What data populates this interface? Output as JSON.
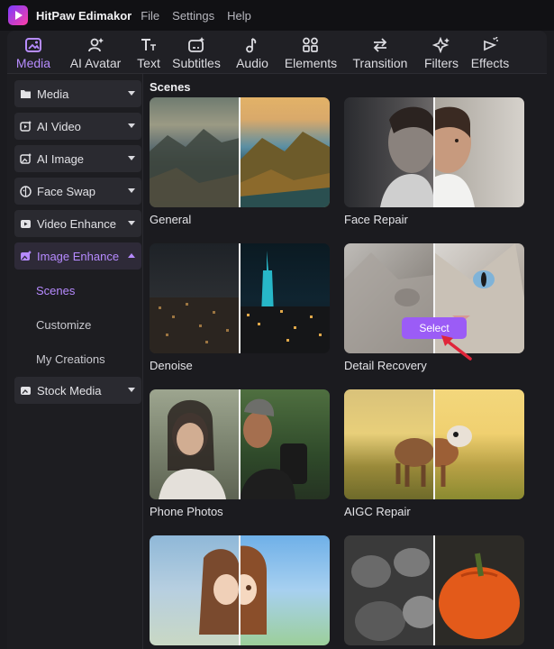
{
  "app": {
    "title": "HitPaw Edimakor"
  },
  "menu": [
    "File",
    "Settings",
    "Help"
  ],
  "toolbar": [
    {
      "label": "Media",
      "icon": "media-icon",
      "active": true
    },
    {
      "label": "AI Avatar",
      "icon": "avatar-icon"
    },
    {
      "label": "Text",
      "icon": "text-icon"
    },
    {
      "label": "Subtitles",
      "icon": "subtitles-icon"
    },
    {
      "label": "Audio",
      "icon": "audio-icon"
    },
    {
      "label": "Elements",
      "icon": "elements-icon"
    },
    {
      "label": "Transition",
      "icon": "transition-icon"
    },
    {
      "label": "Filters",
      "icon": "filters-icon"
    },
    {
      "label": "Effects",
      "icon": "effects-icon"
    }
  ],
  "sidebar": {
    "items": [
      {
        "label": "Media",
        "icon": "folder-icon"
      },
      {
        "label": "AI Video",
        "icon": "ai-video-icon"
      },
      {
        "label": "AI Image",
        "icon": "ai-image-icon"
      },
      {
        "label": "Face Swap",
        "icon": "face-swap-icon"
      },
      {
        "label": "Video Enhance",
        "icon": "video-enhance-icon"
      },
      {
        "label": "Image Enhance",
        "icon": "image-enhance-icon",
        "active": true
      },
      {
        "label": "Stock Media",
        "icon": "stock-media-icon"
      }
    ],
    "sub_items": [
      {
        "label": "Scenes",
        "active": true
      },
      {
        "label": "Customize"
      },
      {
        "label": "My Creations"
      }
    ]
  },
  "content": {
    "section_title": "Scenes",
    "cards": [
      {
        "label": "General"
      },
      {
        "label": "Face Repair"
      },
      {
        "label": "Denoise"
      },
      {
        "label": "Detail Recovery"
      },
      {
        "label": "Phone Photos"
      },
      {
        "label": "AIGC Repair"
      },
      {
        "label": ""
      },
      {
        "label": ""
      }
    ],
    "select_button": "Select"
  },
  "colors": {
    "accent": "#b68aff",
    "select_button": "#9b5cf6",
    "arrow": "#e0263a"
  }
}
